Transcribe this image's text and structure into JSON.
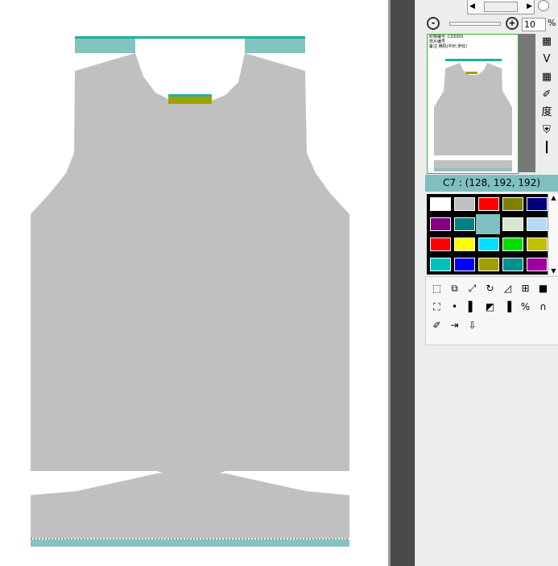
{
  "app": {
    "color_info": "C7 : (128, 192, 192)",
    "zoom": {
      "value": "10",
      "unit": "%"
    },
    "preview_header": [
      "织物编号 :CDDDD",
      "样片编号",
      "备注 横机(平针,罗纹)"
    ],
    "side_tools": [
      "grid-icon",
      "v-shape-icon",
      "table-icon",
      "pen-icon",
      "degree-icon",
      "shield-icon",
      "bars-icon"
    ],
    "side_tool_glyphs": [
      "▦",
      "V",
      "▦",
      "✐",
      "度",
      "⛨",
      "┃"
    ],
    "palette": [
      [
        "#ffffff",
        "#c0c0c0",
        "#ff0000",
        "#808000",
        "#000080"
      ],
      [
        "#800080",
        "#008080",
        "#80c0c0",
        "#d8e8d0",
        "#b8d8f8"
      ],
      [
        "#ff0000",
        "#ffff00",
        "#00e0ff",
        "#00e000",
        "#c0c000"
      ],
      [
        "#00c0c0",
        "#0000ff",
        "#a0a000",
        "#009090",
        "#a000a0"
      ]
    ],
    "toolbar": [
      [
        "select-icon",
        "copy-icon",
        "resize-icon",
        "rotate-360-icon",
        "perspective-icon",
        "grid-cell-icon",
        "fill-black-icon"
      ],
      [
        "bucket-icon",
        "pipe-icon",
        "split-icon",
        "diagonal-icon",
        "stack-icon",
        "chart-icon",
        "arch-icon"
      ],
      [
        "pen-icon",
        "move-row-icon",
        "move-col-icon"
      ]
    ],
    "toolbar_glyphs": [
      [
        "⬚",
        "⧉",
        "⤢",
        "↻",
        "◿",
        "⊞",
        "■"
      ],
      [
        "⛶",
        "•",
        "▌",
        "◩",
        "▐",
        "%",
        "∩"
      ],
      [
        "✐",
        "⇥",
        "⇩"
      ]
    ]
  }
}
